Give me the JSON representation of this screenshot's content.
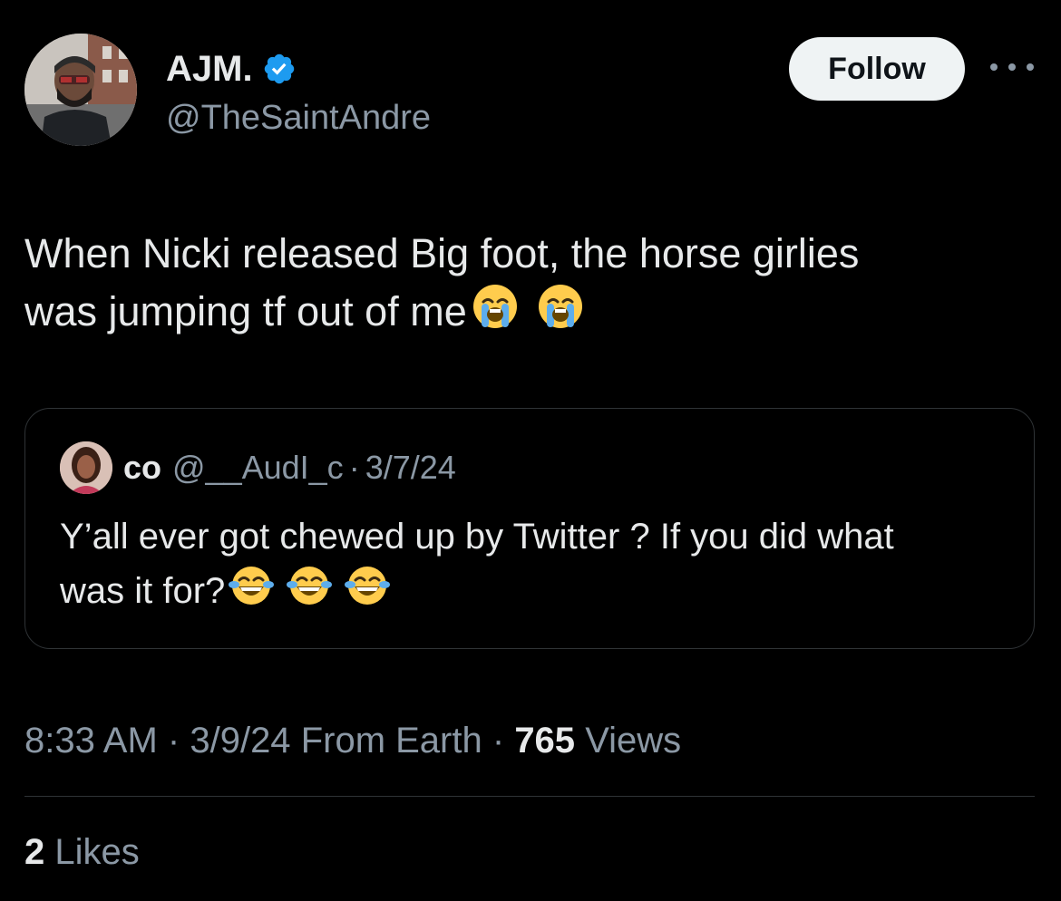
{
  "author": {
    "display_name": "AJM.",
    "handle": "@TheSaintAndre",
    "verified_icon": "verified-badge-icon",
    "avatar_icon": "profile-avatar"
  },
  "follow_label": "Follow",
  "more_icon": "more-options-icon",
  "tweet": {
    "text_line1": "When Nicki released Big foot, the horse girlies",
    "text_line2": "was jumping tf out of me",
    "emoji": [
      "loudly-crying-face-emoji",
      "loudly-crying-face-emoji"
    ]
  },
  "quote": {
    "name": "co",
    "handle": "@__AudI_c",
    "separator": "·",
    "date": "3/7/24",
    "text_line1": "Y’all ever got chewed up by Twitter ? If you did what",
    "text_line2": "was it for?",
    "emoji": [
      "face-with-tears-of-joy-emoji",
      "face-with-tears-of-joy-emoji",
      "face-with-tears-of-joy-emoji"
    ]
  },
  "meta": {
    "time": "8:33 AM",
    "separator": "·",
    "date": "3/9/24",
    "source": "From Earth",
    "views_count": "765",
    "views_label": "Views"
  },
  "likes": {
    "count": "2",
    "label": "Likes"
  },
  "colors": {
    "background": "#000000",
    "text_primary": "#e7e9ea",
    "text_secondary": "#8b98a5",
    "verified": "#1d9bf0",
    "border": "#2f3336"
  }
}
